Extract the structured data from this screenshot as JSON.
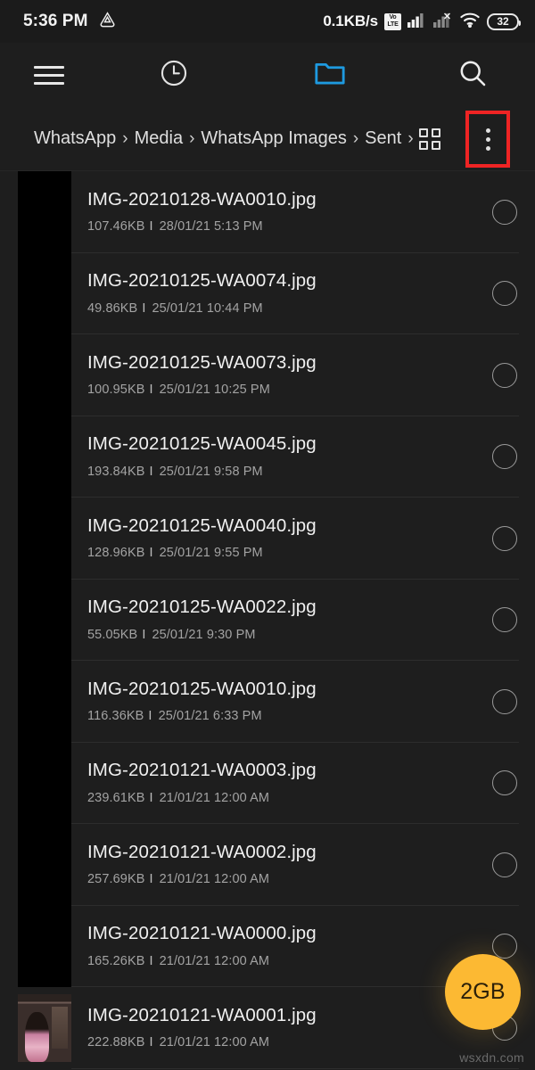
{
  "statusbar": {
    "time": "5:36 PM",
    "drive_icon": "drive-triangle-icon",
    "network_speed": "0.1KB/s",
    "volte_top": "Vo",
    "volte_bottom": "LTE",
    "signal_icon": "signal-bars-icon",
    "signal2_icon": "signal-bars-no-sim-icon",
    "wifi_icon": "wifi-icon",
    "battery": "32"
  },
  "appbar": {
    "menu_icon": "hamburger-menu-icon",
    "recent_icon": "clock-recent-icon",
    "folder_icon": "folder-icon",
    "search_icon": "search-icon",
    "folder_color": "#1e9ae0"
  },
  "breadcrumb": {
    "items": [
      "WhatsApp",
      "Media",
      "WhatsApp Images",
      "Sent"
    ],
    "separator": "›",
    "trailing_separator": "›",
    "grid_icon": "grid-view-icon",
    "overflow_icon": "more-vertical-icon",
    "highlight_color": "#ef2424"
  },
  "fab": {
    "label": "2GB",
    "color": "#fcb933"
  },
  "watermark": "wsxdn.com",
  "files": [
    {
      "name": "IMG-20210128-WA0010.jpg",
      "size": "107.46KB",
      "separator": "I",
      "date": "28/01/21 5:13 PM",
      "thumb": "black"
    },
    {
      "name": "IMG-20210125-WA0074.jpg",
      "size": "49.86KB",
      "separator": "I",
      "date": "25/01/21 10:44 PM",
      "thumb": "black"
    },
    {
      "name": "IMG-20210125-WA0073.jpg",
      "size": "100.95KB",
      "separator": "I",
      "date": "25/01/21 10:25 PM",
      "thumb": "black"
    },
    {
      "name": "IMG-20210125-WA0045.jpg",
      "size": "193.84KB",
      "separator": "I",
      "date": "25/01/21 9:58 PM",
      "thumb": "black"
    },
    {
      "name": "IMG-20210125-WA0040.jpg",
      "size": "128.96KB",
      "separator": "I",
      "date": "25/01/21 9:55 PM",
      "thumb": "black"
    },
    {
      "name": "IMG-20210125-WA0022.jpg",
      "size": "55.05KB",
      "separator": "I",
      "date": "25/01/21 9:30 PM",
      "thumb": "black"
    },
    {
      "name": "IMG-20210125-WA0010.jpg",
      "size": "116.36KB",
      "separator": "I",
      "date": "25/01/21 6:33 PM",
      "thumb": "black"
    },
    {
      "name": "IMG-20210121-WA0003.jpg",
      "size": "239.61KB",
      "separator": "I",
      "date": "21/01/21 12:00 AM",
      "thumb": "black"
    },
    {
      "name": "IMG-20210121-WA0002.jpg",
      "size": "257.69KB",
      "separator": "I",
      "date": "21/01/21 12:00 AM",
      "thumb": "black"
    },
    {
      "name": "IMG-20210121-WA0000.jpg",
      "size": "165.26KB",
      "separator": "I",
      "date": "21/01/21 12:00 AM",
      "thumb": "black"
    },
    {
      "name": "IMG-20210121-WA0001.jpg",
      "size": "222.88KB",
      "separator": "I",
      "date": "21/01/21 12:00 AM",
      "thumb": "photo"
    }
  ]
}
